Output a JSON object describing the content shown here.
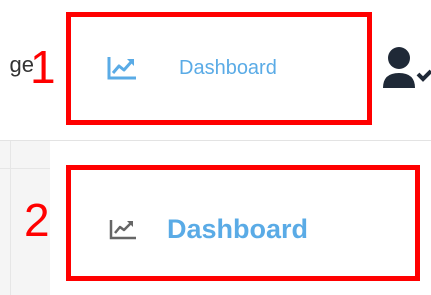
{
  "topbar": {
    "left_cut_text": "ge",
    "dashboard_label": "Dashboard",
    "dashboard_icon": "trend-chart-icon",
    "user_icon": "user-check-icon"
  },
  "dropdown": {
    "dashboard_label": "Dashboard",
    "dashboard_icon": "trend-chart-icon"
  },
  "annotations": {
    "box1_number": "1",
    "box2_number": "2",
    "color": "#ff0000"
  },
  "colors": {
    "accent": "#5aabe6",
    "icon_gray": "#666666",
    "user_icon": "#1f2937"
  }
}
